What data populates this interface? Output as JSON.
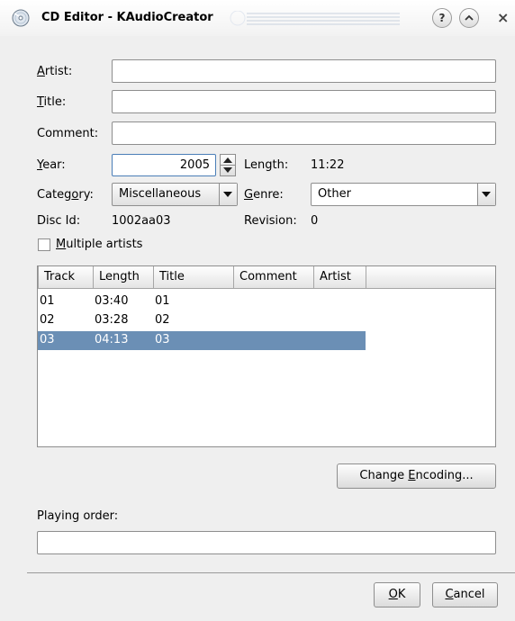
{
  "window": {
    "title": "CD Editor - KAudioCreator",
    "buttons": {
      "help": "?",
      "shade": "^",
      "close": "×"
    }
  },
  "form": {
    "artist": {
      "label_ul": "A",
      "label_rest": "rtist:",
      "value": ""
    },
    "title": {
      "label_ul": "T",
      "label_rest": "itle:",
      "value": ""
    },
    "comment": {
      "label": "Comment:",
      "value": ""
    },
    "year": {
      "label_ul": "Y",
      "label_rest": "ear:",
      "value": "2005"
    },
    "length": {
      "label": "Length:",
      "value": "11:22"
    },
    "category": {
      "label_pre": "Categ",
      "label_ul": "o",
      "label_rest": "ry:",
      "value": "Miscellaneous"
    },
    "genre": {
      "label_ul": "G",
      "label_rest": "enre:",
      "value": "Other"
    },
    "disc_id": {
      "label": "Disc Id:",
      "value": "1002aa03"
    },
    "revision": {
      "label": "Revision:",
      "value": "0"
    },
    "multiple_artists": {
      "label_ul": "M",
      "label_rest": "ultiple artists",
      "checked": false
    }
  },
  "tracks": {
    "columns": [
      "Track",
      "Length",
      "Title",
      "Comment",
      "Artist"
    ],
    "rows": [
      {
        "track": "01",
        "length": "03:40",
        "title": "01",
        "selected": false
      },
      {
        "track": "02",
        "length": "03:28",
        "title": "02",
        "selected": false
      },
      {
        "track": "03",
        "length": "04:13",
        "title": "03",
        "selected": true
      }
    ]
  },
  "change_encoding": {
    "label_pre": "Change ",
    "label_ul": "E",
    "label_rest": "ncoding..."
  },
  "playing_order": {
    "label": "Playing order:",
    "value": ""
  },
  "ok": {
    "label_ul": "O",
    "label_rest": "K"
  },
  "cancel": {
    "label_ul": "C",
    "label_rest": "ancel"
  },
  "colors": {
    "selection": "#6b8fb5",
    "focus_border": "#4a7eb7"
  }
}
